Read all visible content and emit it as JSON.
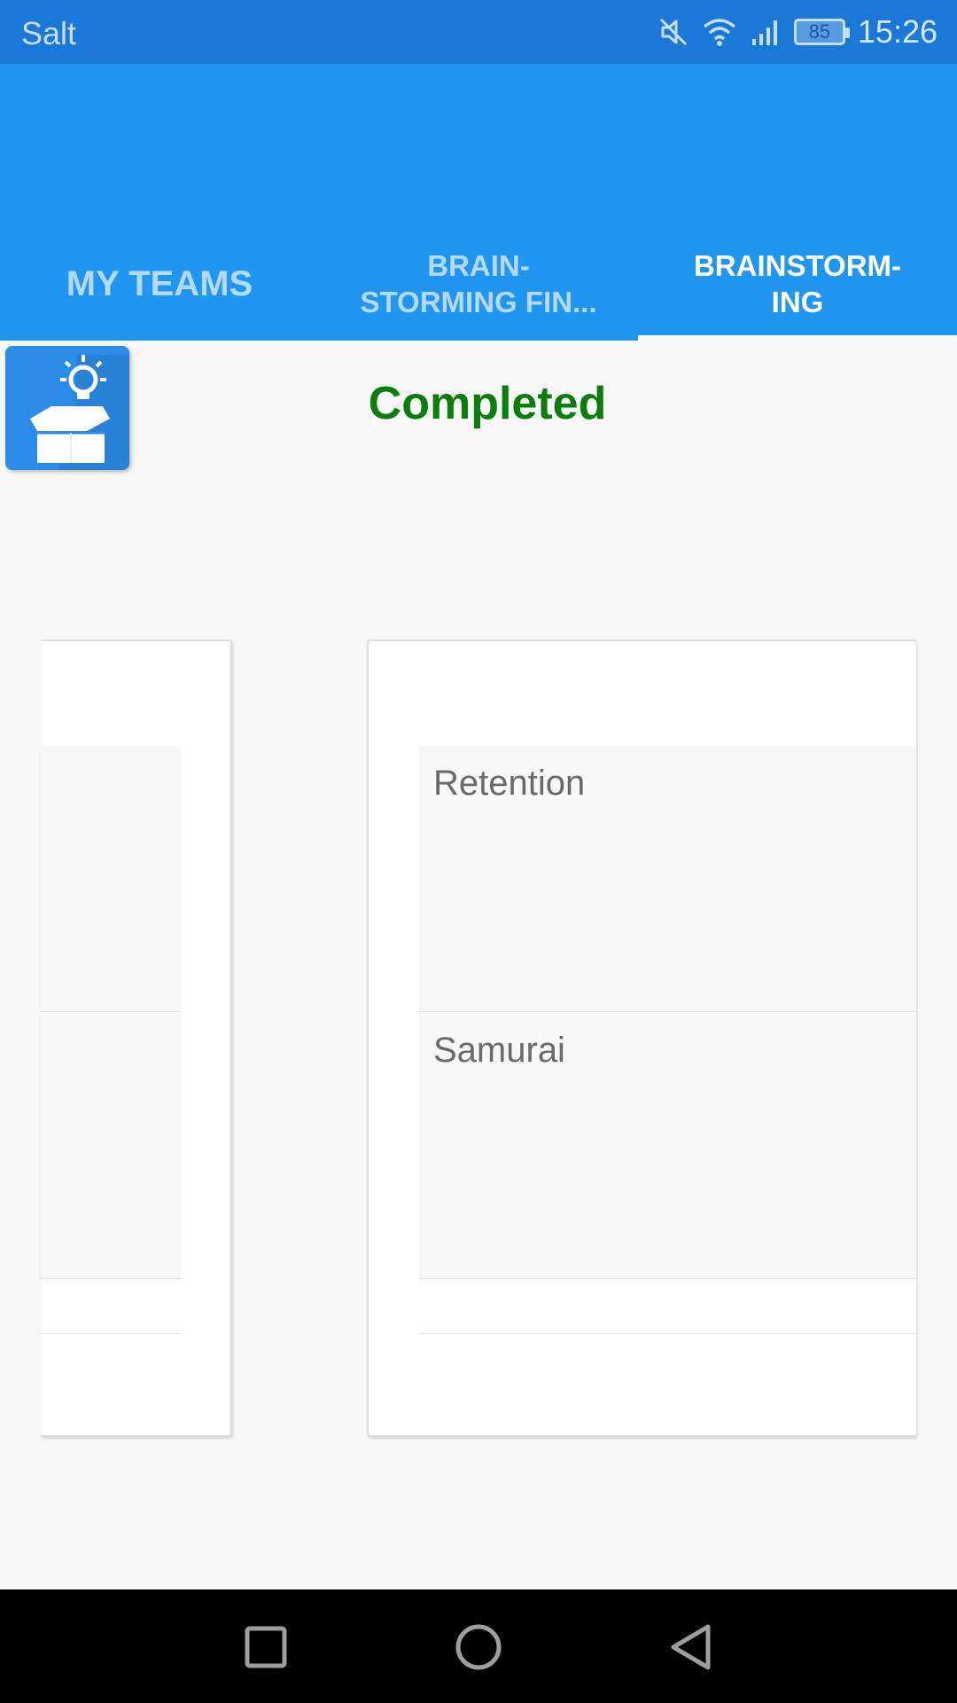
{
  "status_bar": {
    "carrier": "Salt",
    "battery": "85",
    "time": "15:26",
    "icons": [
      "mute-icon",
      "wifi-icon",
      "signal-icon",
      "battery-icon"
    ]
  },
  "tabs": [
    {
      "label": "MY TEAMS",
      "active": false
    },
    {
      "label": "BRAIN-\nSTORMING FIN...",
      "active": false
    },
    {
      "label": "BRAINSTORM-\nING",
      "active": true
    }
  ],
  "header": {
    "logo_icon": "idea-box-icon",
    "status": "Completed"
  },
  "cards": {
    "right": {
      "items": [
        "Retention",
        "Samurai"
      ]
    }
  },
  "nav_bar": {
    "icons": [
      "recents-square-icon",
      "home-circle-icon",
      "back-triangle-icon"
    ]
  },
  "colors": {
    "status_bar": "#1c78d6",
    "app_bar": "#2196f0",
    "completed": "#0b7d0b"
  }
}
